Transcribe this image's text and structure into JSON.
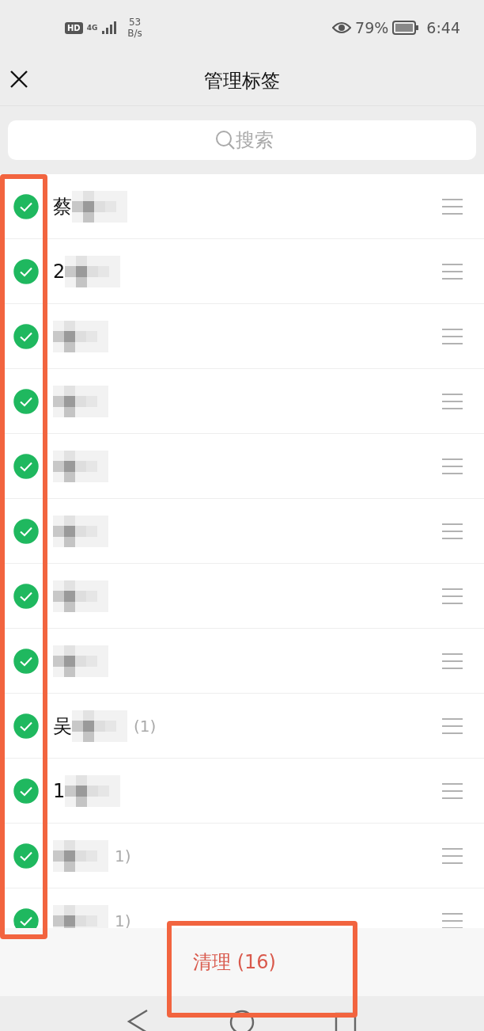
{
  "status_bar": {
    "hd": "HD",
    "network": "4G",
    "speed_value": "53",
    "speed_unit": "B/s",
    "battery": "79%",
    "time": "6:44"
  },
  "header": {
    "title": "管理标签"
  },
  "search": {
    "placeholder": "搜索"
  },
  "tags": [
    {
      "name": "蔡",
      "redacted": true,
      "checked": true
    },
    {
      "name": "2",
      "redacted": true,
      "checked": true
    },
    {
      "redacted": true,
      "checked": true
    },
    {
      "redacted": true,
      "checked": true
    },
    {
      "redacted": true,
      "checked": true
    },
    {
      "redacted": true,
      "checked": true
    },
    {
      "redacted": true,
      "checked": true
    },
    {
      "redacted": true,
      "checked": true
    },
    {
      "name": "吴",
      "redacted": true,
      "count": "(1)",
      "checked": true
    },
    {
      "name": "1",
      "redacted": true,
      "checked": true
    },
    {
      "redacted": true,
      "count": "1)",
      "checked": true
    },
    {
      "redacted": true,
      "count": "1)",
      "checked": true
    }
  ],
  "footer": {
    "button": "清理 (16)"
  }
}
